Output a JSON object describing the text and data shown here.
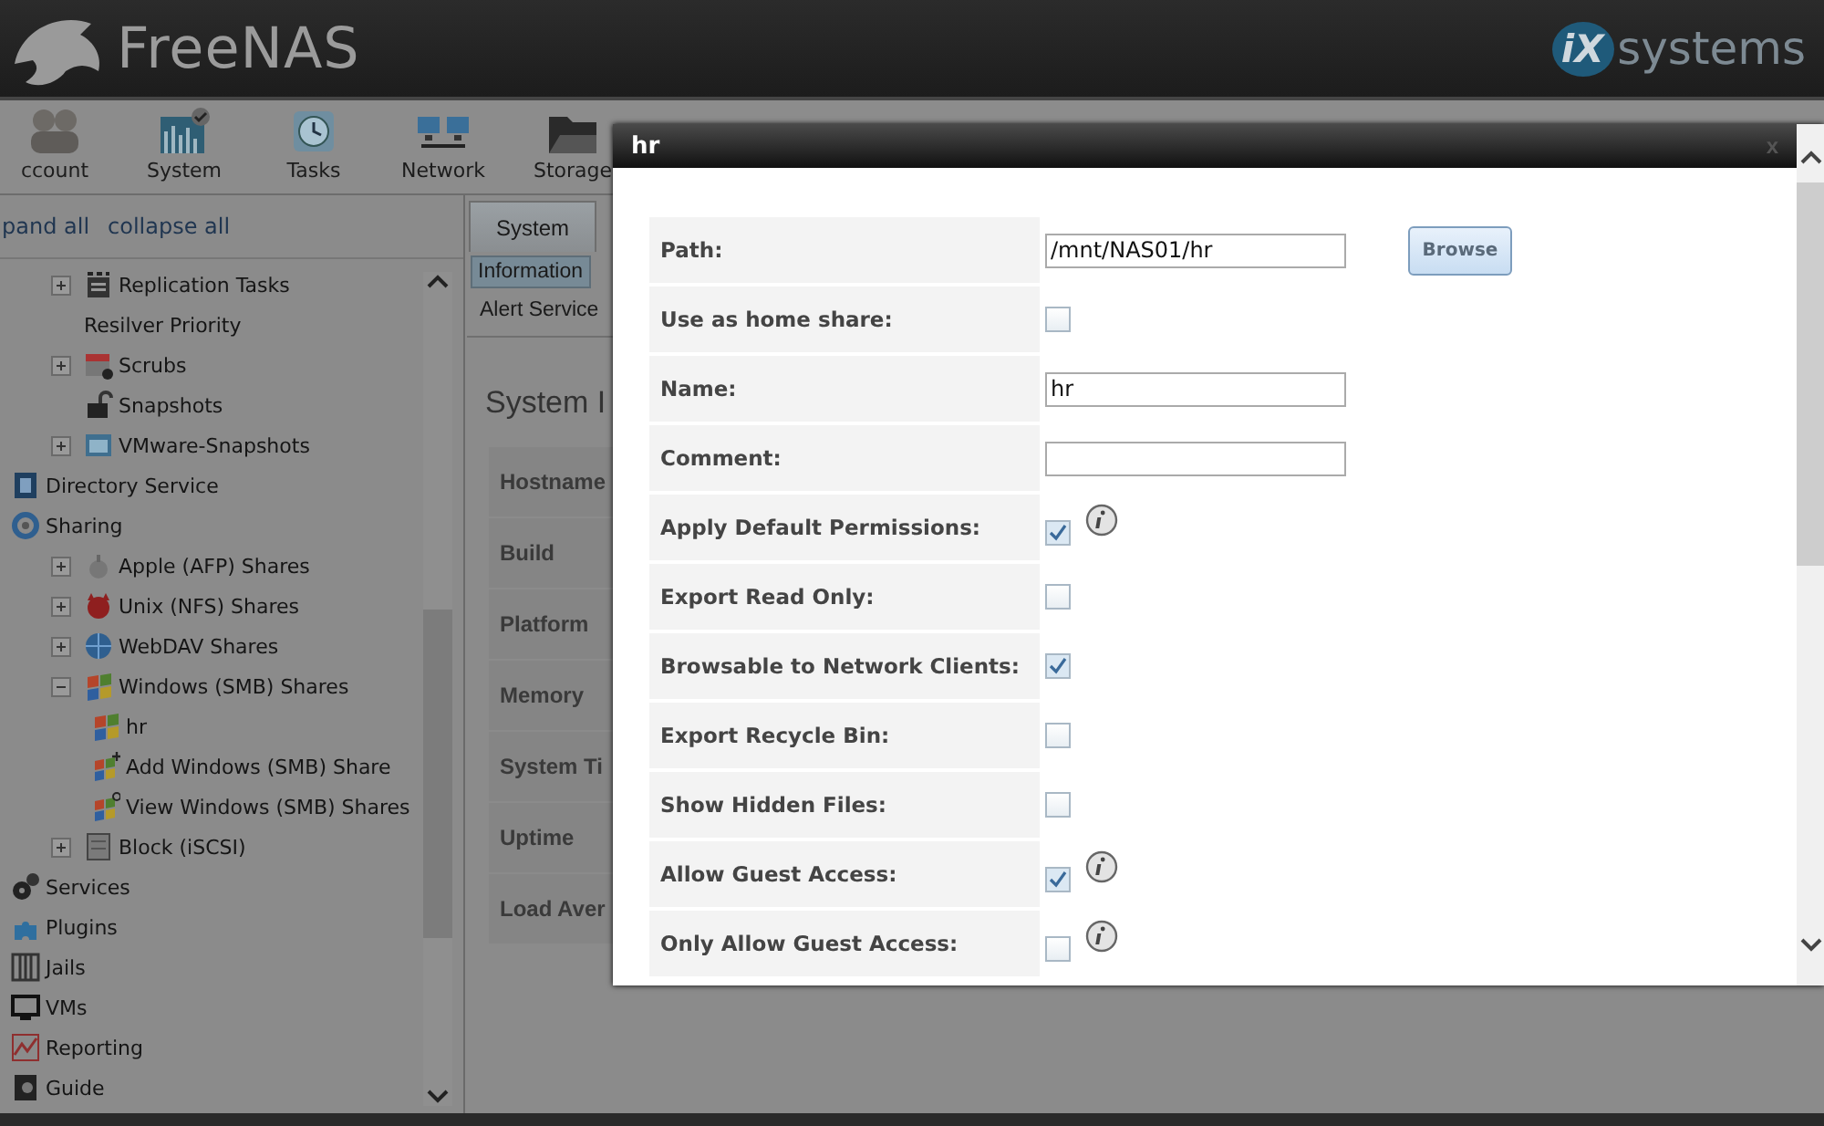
{
  "header": {
    "product": "FreeNAS",
    "vendor_mark": "iX",
    "vendor": "systems"
  },
  "toolbar": [
    {
      "label": "ccount"
    },
    {
      "label": "System"
    },
    {
      "label": "Tasks"
    },
    {
      "label": "Network"
    },
    {
      "label": "Storage"
    }
  ],
  "tree_links": [
    "pand all",
    "collapse all"
  ],
  "sidebar": {
    "continued_children": [
      {
        "label": "Replication Tasks",
        "expanded": false
      },
      {
        "label": "Resilver Priority"
      },
      {
        "label": "Scrubs",
        "expanded": false
      },
      {
        "label": "Snapshots"
      },
      {
        "label": "VMware-Snapshots",
        "expanded": false
      }
    ],
    "items": [
      {
        "label": "Directory Service"
      },
      {
        "label": "Sharing",
        "children": [
          {
            "label": "Apple (AFP) Shares",
            "expanded": false
          },
          {
            "label": "Unix (NFS) Shares",
            "expanded": false
          },
          {
            "label": "WebDAV Shares",
            "expanded": false
          },
          {
            "label": "Windows (SMB) Shares",
            "expanded": true,
            "children": [
              {
                "label": "hr"
              },
              {
                "label": "Add Windows (SMB) Share"
              },
              {
                "label": "View Windows (SMB) Shares"
              }
            ]
          },
          {
            "label": "Block (iSCSI)",
            "expanded": false
          }
        ]
      },
      {
        "label": "Services"
      },
      {
        "label": "Plugins"
      },
      {
        "label": "Jails"
      },
      {
        "label": "VMs"
      },
      {
        "label": "Reporting"
      },
      {
        "label": "Guide"
      }
    ]
  },
  "main": {
    "tabs": [
      {
        "label": "System",
        "selected": true
      }
    ],
    "subtabs": [
      {
        "label": "Information",
        "selected": true
      },
      {
        "label": "Alert Service",
        "selected": false
      }
    ],
    "heading": "System I",
    "info_rows": [
      "Hostname",
      "Build",
      "Platform",
      "Memory",
      "System Ti",
      "Uptime",
      "Load Aver"
    ]
  },
  "dialog": {
    "title": "hr",
    "close": "x",
    "fields": [
      {
        "kind": "text",
        "label": "Path:",
        "value": "/mnt/NAS01/hr",
        "button": "Browse"
      },
      {
        "kind": "checkbox",
        "label": "Use as home share:",
        "checked": false,
        "info": false
      },
      {
        "kind": "text",
        "label": "Name:",
        "value": "hr"
      },
      {
        "kind": "text",
        "label": "Comment:"
      },
      {
        "kind": "checkbox",
        "label": "Apply Default Permissions:",
        "checked": true,
        "info": true
      },
      {
        "kind": "checkbox",
        "label": "Export Read Only:",
        "checked": false,
        "info": false
      },
      {
        "kind": "checkbox",
        "label": "Browsable to Network Clients:",
        "checked": true,
        "info": false
      },
      {
        "kind": "checkbox",
        "label": "Export Recycle Bin:",
        "checked": false,
        "info": false
      },
      {
        "kind": "checkbox",
        "label": "Show Hidden Files:",
        "checked": false,
        "info": false
      },
      {
        "kind": "checkbox",
        "label": "Allow Guest Access:",
        "checked": true,
        "info": true
      },
      {
        "kind": "checkbox",
        "label": "Only Allow Guest Access:",
        "checked": false,
        "info": true
      }
    ]
  }
}
